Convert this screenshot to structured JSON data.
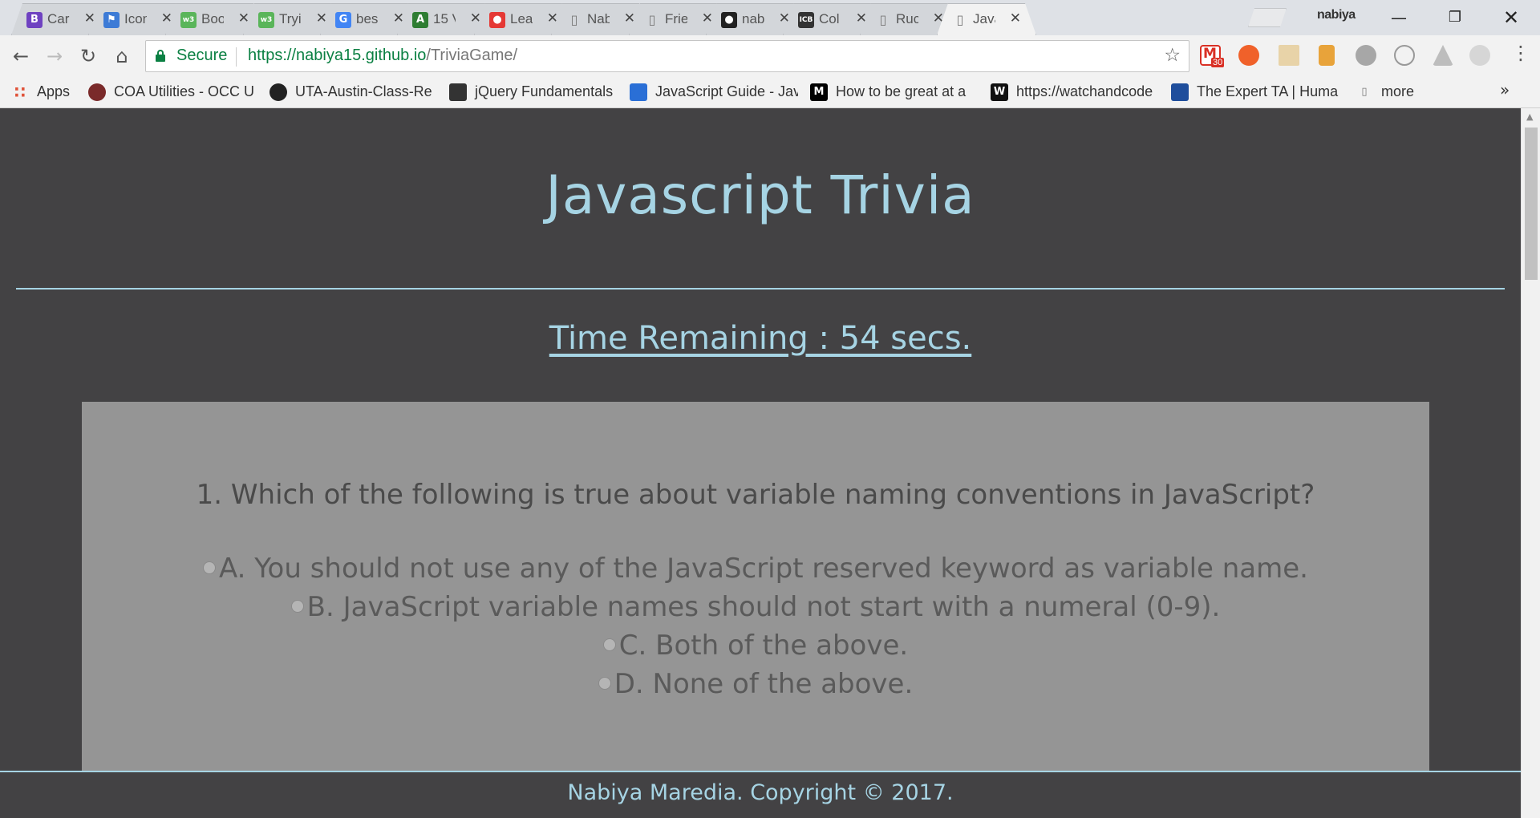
{
  "browser": {
    "tabs": [
      {
        "title": "Car",
        "favicon": "bootstrap-icon",
        "color": "#6f42c1",
        "glyph": "B"
      },
      {
        "title": "Icon",
        "favicon": "flag-icon",
        "color": "#3d7bd6",
        "glyph": "⚑"
      },
      {
        "title": "Boo",
        "favicon": "w3-icon",
        "color": "#5ab55a",
        "glyph": "w3"
      },
      {
        "title": "Tryi",
        "favicon": "w3-icon",
        "color": "#5ab55a",
        "glyph": "w3"
      },
      {
        "title": "bes",
        "favicon": "google-icon",
        "color": "#4285f4",
        "glyph": "G"
      },
      {
        "title": "15 V",
        "favicon": "app-icon",
        "color": "#2e7d32",
        "glyph": "A"
      },
      {
        "title": "Lea",
        "favicon": "learn-icon",
        "color": "#e53935",
        "glyph": "●"
      },
      {
        "title": "Nab",
        "favicon": "page-icon",
        "color": "#9e9e9e",
        "glyph": "▯"
      },
      {
        "title": "Frie",
        "favicon": "page-icon",
        "color": "#9e9e9e",
        "glyph": "▯"
      },
      {
        "title": "nab",
        "favicon": "github-icon",
        "color": "#222222",
        "glyph": "●"
      },
      {
        "title": "Col",
        "favicon": "icb-icon",
        "color": "#333333",
        "glyph": "ICB"
      },
      {
        "title": "Ruc",
        "favicon": "page-icon",
        "color": "#9e9e9e",
        "glyph": "▯"
      },
      {
        "title": "Java",
        "favicon": "page-icon",
        "color": "#9e9e9e",
        "glyph": "▯"
      }
    ],
    "profile_name": "nabiya",
    "omnibox": {
      "secure_label": "Secure",
      "url_host": "https://nabiya15.github.io",
      "url_path": "/TriviaGame/"
    },
    "gmail_badge": "30",
    "bookmarks": [
      {
        "label": "Apps",
        "icon": "apps-grid-icon",
        "color": "#e0533a"
      },
      {
        "label": "COA Utilities - OCC U",
        "icon": "seal-icon",
        "color": "#7a2a2a"
      },
      {
        "label": "UTA-Austin-Class-Re",
        "icon": "github-icon",
        "color": "#222222"
      },
      {
        "label": "jQuery Fundamentals",
        "icon": "rooster-icon",
        "color": "#333333"
      },
      {
        "label": "JavaScript Guide - Jav",
        "icon": "mdn-icon",
        "color": "#2a6fd6"
      },
      {
        "label": "How to be great at a",
        "icon": "medium-icon",
        "color": "#000000"
      },
      {
        "label": "https://watchandcode",
        "icon": "w-icon",
        "color": "#111111"
      },
      {
        "label": "The Expert TA | Huma",
        "icon": "expertta-icon",
        "color": "#1f4e9c"
      },
      {
        "label": "more",
        "icon": "page-icon",
        "color": "#9e9e9e"
      }
    ]
  },
  "page": {
    "title": "Javascript Trivia",
    "timer_text": "Time Remaining : 54 secs.",
    "question": "1. Which of the following is true about variable naming conventions in JavaScript?",
    "options": [
      "A. You should not use any of the JavaScript reserved keyword as variable name.",
      "B. JavaScript variable names should not start with a numeral (0-9).",
      "C. Both of the above.",
      "D. None of the above."
    ],
    "footer": "Nabiya Maredia. Copyright © 2017."
  },
  "colors": {
    "accent": "#a6d4e4",
    "page_background": "#434244",
    "card_background": "#959595",
    "secure_green": "#0b8043"
  }
}
